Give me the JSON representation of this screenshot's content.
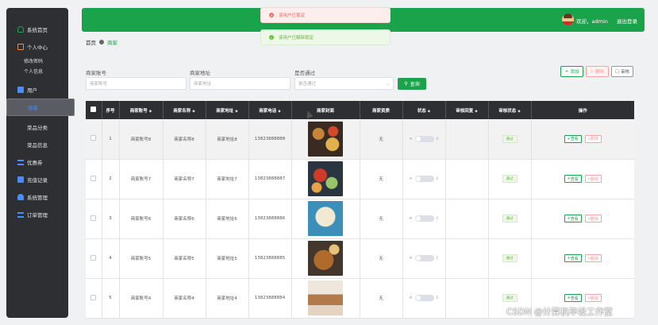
{
  "sidebar": {
    "items": [
      {
        "label": "系统首页",
        "icon": "home-icon"
      },
      {
        "label": "个人中心",
        "icon": "user-center-icon"
      },
      {
        "label": "修改密码",
        "sub": true
      },
      {
        "label": "个人信息",
        "sub": true
      },
      {
        "label": "用户",
        "icon": "user-icon"
      },
      {
        "label": "商家",
        "icon": "store-icon",
        "active": true
      },
      {
        "label": "菜品分类",
        "icon": "category-icon"
      },
      {
        "label": "菜品信息",
        "icon": "dish-icon"
      },
      {
        "label": "优惠券",
        "icon": "coupon-icon"
      },
      {
        "label": "充值记录",
        "icon": "recharge-icon"
      },
      {
        "label": "系统管理",
        "icon": "system-icon"
      },
      {
        "label": "订单管理",
        "icon": "order-icon"
      }
    ]
  },
  "header": {
    "welcome": "欢迎，admin",
    "logout": "退出登录"
  },
  "toasts": {
    "error": "该用户已锁定",
    "success": "该用户已解除锁定"
  },
  "breadcrumb": {
    "home": "首页",
    "current": "商家"
  },
  "search": {
    "account_label": "商家账号",
    "account_placeholder": "商家账号",
    "address_label": "商家地址",
    "address_placeholder": "商家地址",
    "pass_label": "是否通过",
    "pass_placeholder": "是否通过",
    "button": "查询"
  },
  "toolbar": {
    "add": "添加",
    "delete": "删除",
    "audit": "审核"
  },
  "table": {
    "headers": [
      "序号",
      "商家账号",
      "商家名称",
      "商家地址",
      "商家电话",
      "商家封面",
      "商家资质",
      "状态",
      "审核回复",
      "审核状态",
      "操作"
    ],
    "rows": [
      {
        "index": "1",
        "account": "商家账号8",
        "name": "商家名称8",
        "address": "商家地址8",
        "phone": "13823888888",
        "license": "无",
        "reply": "",
        "audit": "通过"
      },
      {
        "index": "2",
        "account": "商家账号7",
        "name": "商家名称7",
        "address": "商家地址7",
        "phone": "13823888887",
        "license": "无",
        "reply": "",
        "audit": "通过"
      },
      {
        "index": "3",
        "account": "商家账号6",
        "name": "商家名称6",
        "address": "商家地址6",
        "phone": "13823888886",
        "license": "无",
        "reply": "",
        "audit": "通过"
      },
      {
        "index": "4",
        "account": "商家账号5",
        "name": "商家名称5",
        "address": "商家地址5",
        "phone": "13823888885",
        "license": "无",
        "reply": "",
        "audit": "通过"
      },
      {
        "index": "5",
        "account": "商家账号4",
        "name": "商家名称4",
        "address": "商家地址4",
        "phone": "13823888884",
        "license": "无",
        "reply": "",
        "audit": "通过"
      }
    ],
    "view_label": "查看",
    "delete_label": "删除"
  },
  "watermark": "CSDN @计算机毕设工作室",
  "colors": {
    "primary": "#1aa34a",
    "sidebar": "#2e2f33",
    "danger": "#f56c6c"
  }
}
